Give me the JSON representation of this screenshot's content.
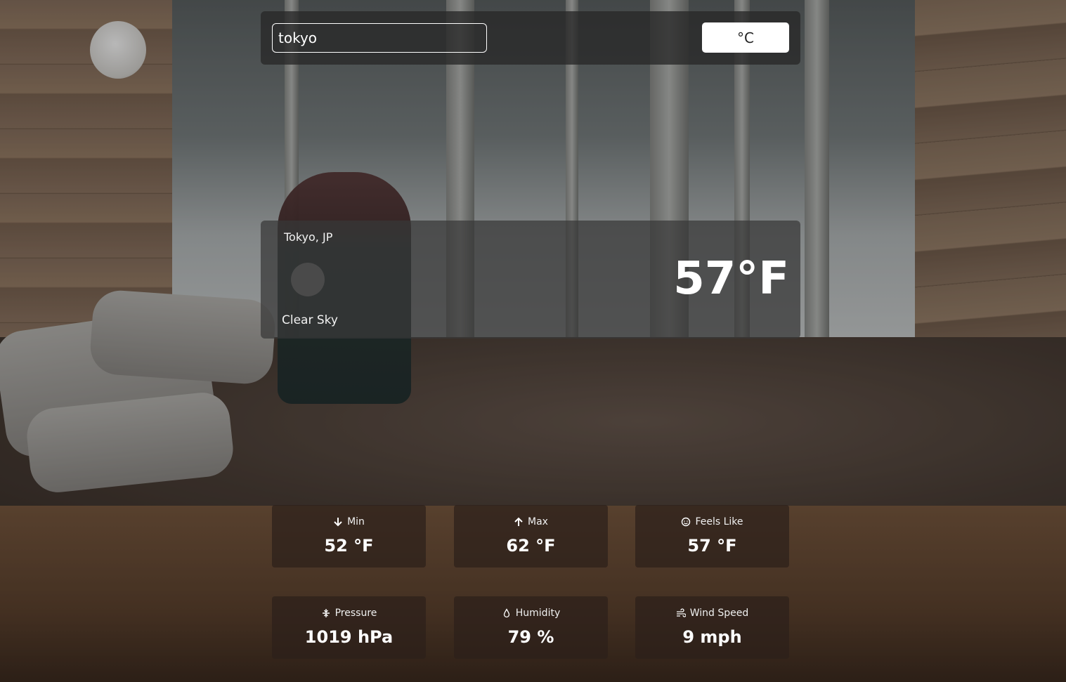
{
  "search": {
    "value": "tokyo"
  },
  "unit_toggle": {
    "label": "°C"
  },
  "current": {
    "location": "Tokyo, JP",
    "condition": "Clear Sky",
    "temperature": "57°F",
    "icon": "weather-icon"
  },
  "stats": [
    {
      "label": "Min",
      "value": "52 °F",
      "icon": "arrow-down-icon"
    },
    {
      "label": "Max",
      "value": "62 °F",
      "icon": "arrow-up-icon"
    },
    {
      "label": "Feels Like",
      "value": "57 °F",
      "icon": "smiley-icon"
    },
    {
      "label": "Pressure",
      "value": "1019 hPa",
      "icon": "compress-icon"
    },
    {
      "label": "Humidity",
      "value": "79 %",
      "icon": "droplet-icon"
    },
    {
      "label": "Wind Speed",
      "value": "9 mph",
      "icon": "wind-icon"
    }
  ]
}
